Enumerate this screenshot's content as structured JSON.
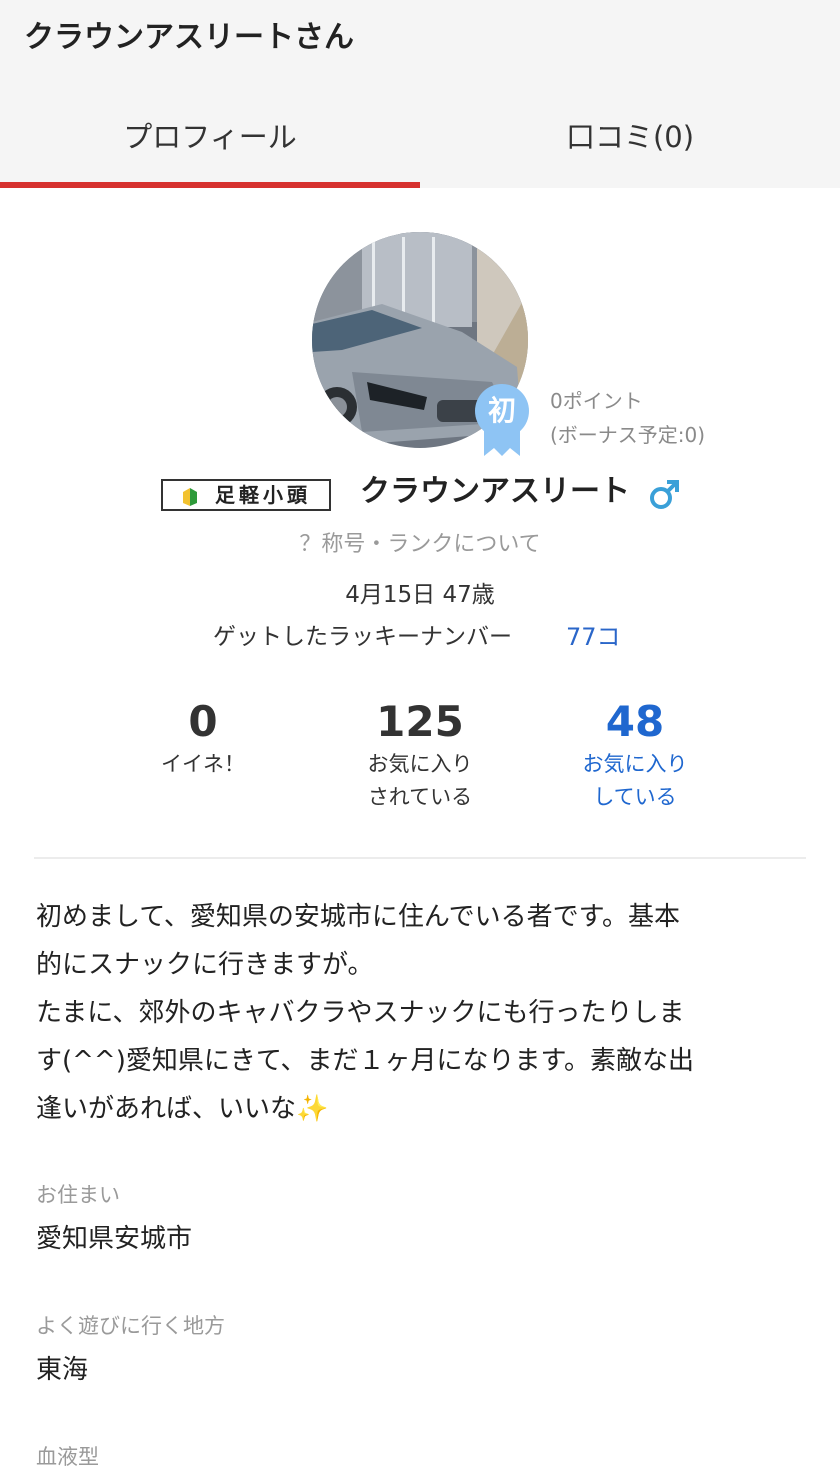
{
  "header": {
    "title": "クラウンアスリートさん",
    "tabs": [
      {
        "label": "プロフィール",
        "active": true
      },
      {
        "label": "口コミ(0)",
        "active": false
      }
    ],
    "active_color": "#d6312f"
  },
  "profile": {
    "badge_text": "初",
    "points": "0ポイント",
    "bonus": "(ボーナス予定:0)",
    "rank": "足軽小頭",
    "username": "クラウンアスリート",
    "gender_icon": "male-icon",
    "rank_link": "？称号・ランクについて",
    "birthday_age": "4月15日 47歳",
    "lucky_label": "ゲットしたラッキーナンバー",
    "lucky_value": "77コ"
  },
  "stats": [
    {
      "value": "0",
      "label": "イイネ！"
    },
    {
      "value": "125",
      "label": "お気に入り\nされている"
    },
    {
      "value": "48",
      "label": "お気に入り\nしている"
    }
  ],
  "intro": "初めまして、愛知県の安城市に住んでいる者です。基本\n的にスナックに行きますが。\nたまに、郊外のキャバクラやスナックにも行ったりしま\nす(^^)愛知県にきて、まだ１ヶ月になります。素敵な出\n逢いがあれば、いいな✨",
  "fields": [
    {
      "label": "お住まい",
      "value": "愛知県安城市"
    },
    {
      "label": "よく遊びに行く地方",
      "value": "東海"
    },
    {
      "label": "血液型",
      "value": ""
    }
  ],
  "colors": {
    "link": "#2a66c9",
    "accent_blue": "#1f67cf",
    "gender": "#3aa0d8"
  }
}
